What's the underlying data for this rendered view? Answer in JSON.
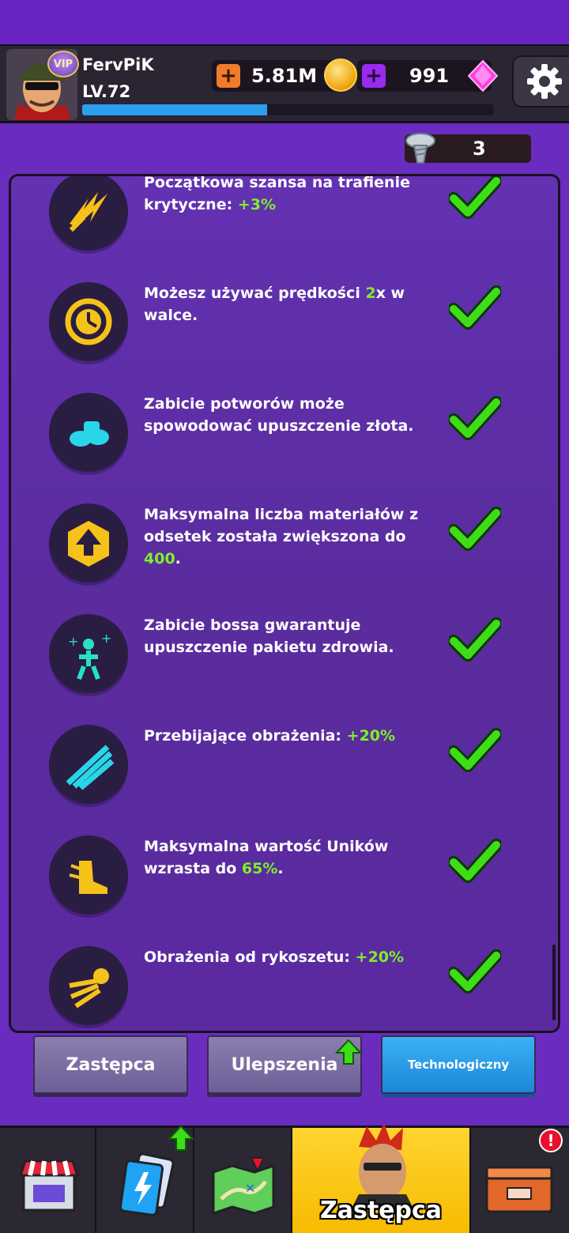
{
  "player": {
    "name": "FervPiK",
    "level": "LV.72",
    "vip": "VIP",
    "xp_progress": 0.45
  },
  "currency": {
    "coins": "5.81M",
    "gems": "991",
    "bolts": "3",
    "plus": "+"
  },
  "perks": [
    {
      "text": "Początkowa szansa na trafienie krytyczne: ",
      "highlight": "+3%",
      "suffix": "",
      "icon": "critical-hit-icon"
    },
    {
      "text": "Możesz używać prędkości ",
      "highlight": "2",
      "suffix": "x w walce.",
      "icon": "speed-clock-icon"
    },
    {
      "text": "Zabicie potworów może spowodować upuszczenie złota.",
      "highlight": "",
      "suffix": "",
      "icon": "gold-drop-icon"
    },
    {
      "text": "Maksymalna liczba materiałów z odsetek została zwiększona do ",
      "highlight": "400",
      "suffix": ".",
      "icon": "materials-cap-icon"
    },
    {
      "text": "Zabicie bossa gwarantuje upuszczenie pakietu zdrowia.",
      "highlight": "",
      "suffix": "",
      "icon": "health-pack-icon"
    },
    {
      "text": "Przebijające obrażenia: ",
      "highlight": "+20%",
      "suffix": "",
      "icon": "piercing-damage-icon"
    },
    {
      "text": "Maksymalna wartość Uników wzrasta do ",
      "highlight": "65%",
      "suffix": ".",
      "icon": "dodge-boot-icon"
    },
    {
      "text": "Obrażenia od rykoszetu: ",
      "highlight": "+20%",
      "suffix": "",
      "icon": "ricochet-icon"
    }
  ],
  "tabs": {
    "deputy": "Zastępca",
    "upgrades": "Ulepszenia",
    "tech": "Technologiczny"
  },
  "nav": {
    "active_label": "Zastępca",
    "alert": "!"
  },
  "colors": {
    "highlight": "#7cf02a",
    "check": "#3fdc1a",
    "active_nav": "#ffd430"
  }
}
